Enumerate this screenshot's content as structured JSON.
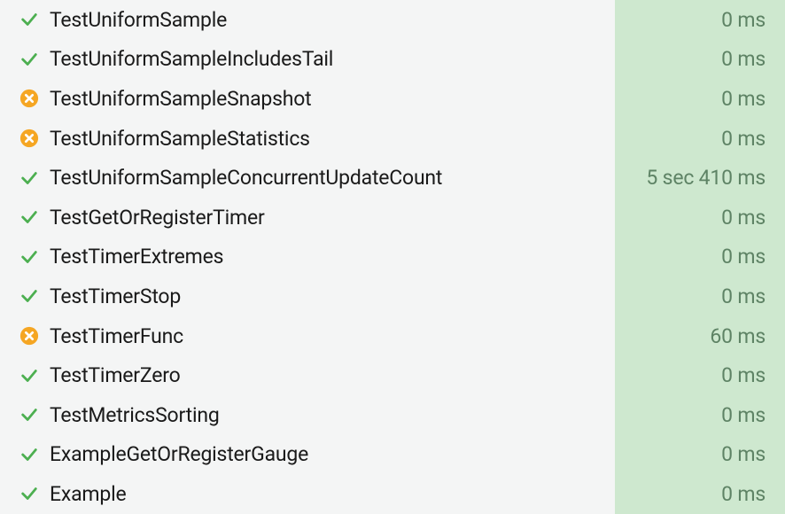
{
  "tests": [
    {
      "status": "pass",
      "name": "TestUniformSample",
      "duration": "0 ms"
    },
    {
      "status": "pass",
      "name": "TestUniformSampleIncludesTail",
      "duration": "0 ms"
    },
    {
      "status": "fail",
      "name": "TestUniformSampleSnapshot",
      "duration": "0 ms"
    },
    {
      "status": "fail",
      "name": "TestUniformSampleStatistics",
      "duration": "0 ms"
    },
    {
      "status": "pass",
      "name": "TestUniformSampleConcurrentUpdateCount",
      "duration": "5 sec 410 ms"
    },
    {
      "status": "pass",
      "name": "TestGetOrRegisterTimer",
      "duration": "0 ms"
    },
    {
      "status": "pass",
      "name": "TestTimerExtremes",
      "duration": "0 ms"
    },
    {
      "status": "pass",
      "name": "TestTimerStop",
      "duration": "0 ms"
    },
    {
      "status": "fail",
      "name": "TestTimerFunc",
      "duration": "60 ms"
    },
    {
      "status": "pass",
      "name": "TestTimerZero",
      "duration": "0 ms"
    },
    {
      "status": "pass",
      "name": "TestMetricsSorting",
      "duration": "0 ms"
    },
    {
      "status": "pass",
      "name": "ExampleGetOrRegisterGauge",
      "duration": "0 ms"
    },
    {
      "status": "pass",
      "name": "Example",
      "duration": "0 ms"
    }
  ]
}
